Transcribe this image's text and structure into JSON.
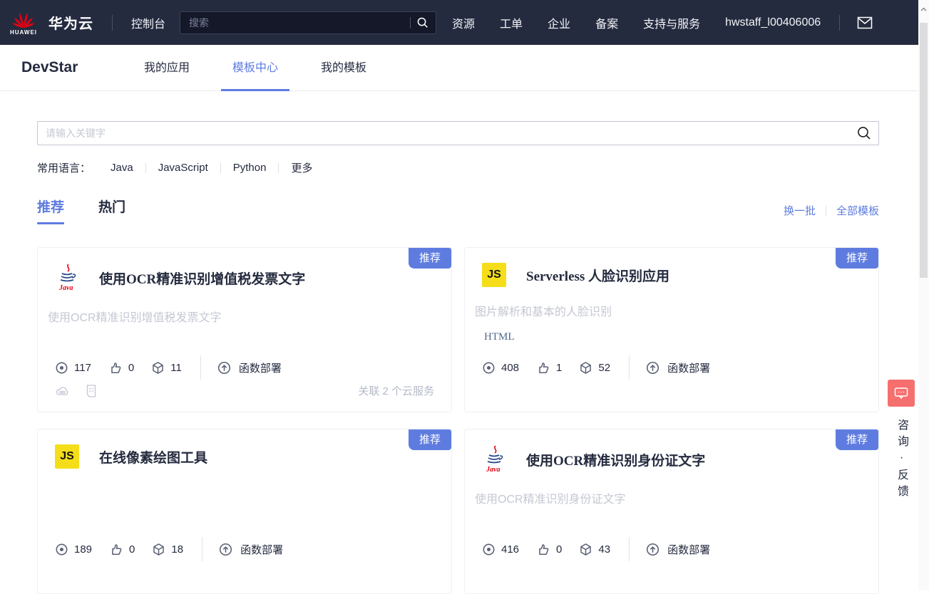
{
  "topbar": {
    "logo_word": "HUAWEI",
    "brand": "华为云",
    "console": "控制台",
    "search_placeholder": "搜索",
    "menu": [
      "资源",
      "工单",
      "企业",
      "备案",
      "支持与服务"
    ],
    "username": "hwstaff_l00406006"
  },
  "subnav": {
    "product": "DevStar",
    "tabs": [
      {
        "label": "我的应用",
        "active": false
      },
      {
        "label": "模板中心",
        "active": true
      },
      {
        "label": "我的模板",
        "active": false
      }
    ]
  },
  "search": {
    "placeholder": "请输入关键字"
  },
  "languages": {
    "label": "常用语言：",
    "items": [
      "Java",
      "JavaScript",
      "Python",
      "更多"
    ]
  },
  "tabs": {
    "items": [
      {
        "label": "推荐",
        "active": true
      },
      {
        "label": "热门",
        "active": false
      }
    ],
    "actions": [
      {
        "label": "换一批"
      },
      {
        "label": "全部模板"
      }
    ]
  },
  "cards": [
    {
      "icon": "java-icon",
      "badge": "推荐",
      "title": "使用OCR精准识别增值税发票文字",
      "subtitle": "使用OCR精准识别增值税发票文字",
      "views": "117",
      "likes": "0",
      "uses": "11",
      "deploy_label": "函数部署",
      "footer_note": "关联 2 个云服务"
    },
    {
      "icon": "js-icon",
      "badge": "推荐",
      "title": "Serverless 人脸识别应用",
      "subtitle": "图片解析和基本的人脸识别",
      "tag": "HTML",
      "views": "408",
      "likes": "1",
      "uses": "52",
      "deploy_label": "函数部署"
    },
    {
      "icon": "js-icon",
      "badge": "推荐",
      "title": "在线像素绘图工具",
      "views": "189",
      "likes": "0",
      "uses": "18",
      "deploy_label": "函数部署"
    },
    {
      "icon": "java-icon",
      "badge": "推荐",
      "title": "使用OCR精准识别身份证文字",
      "subtitle": "使用OCR精准识别身份证文字",
      "views": "416",
      "likes": "0",
      "uses": "43",
      "deploy_label": "函数部署"
    }
  ],
  "java_icon_text": "Java",
  "js_icon_text": "JS",
  "feedback": {
    "label": "咨询·反馈"
  },
  "colors": {
    "topbar_bg": "#252b3f",
    "primary": "#5e7ce0",
    "badge": "#5e7ce0",
    "feedback_red": "#f66f6f",
    "js_yellow": "#f5de19",
    "huawei_red": "#e60012"
  }
}
